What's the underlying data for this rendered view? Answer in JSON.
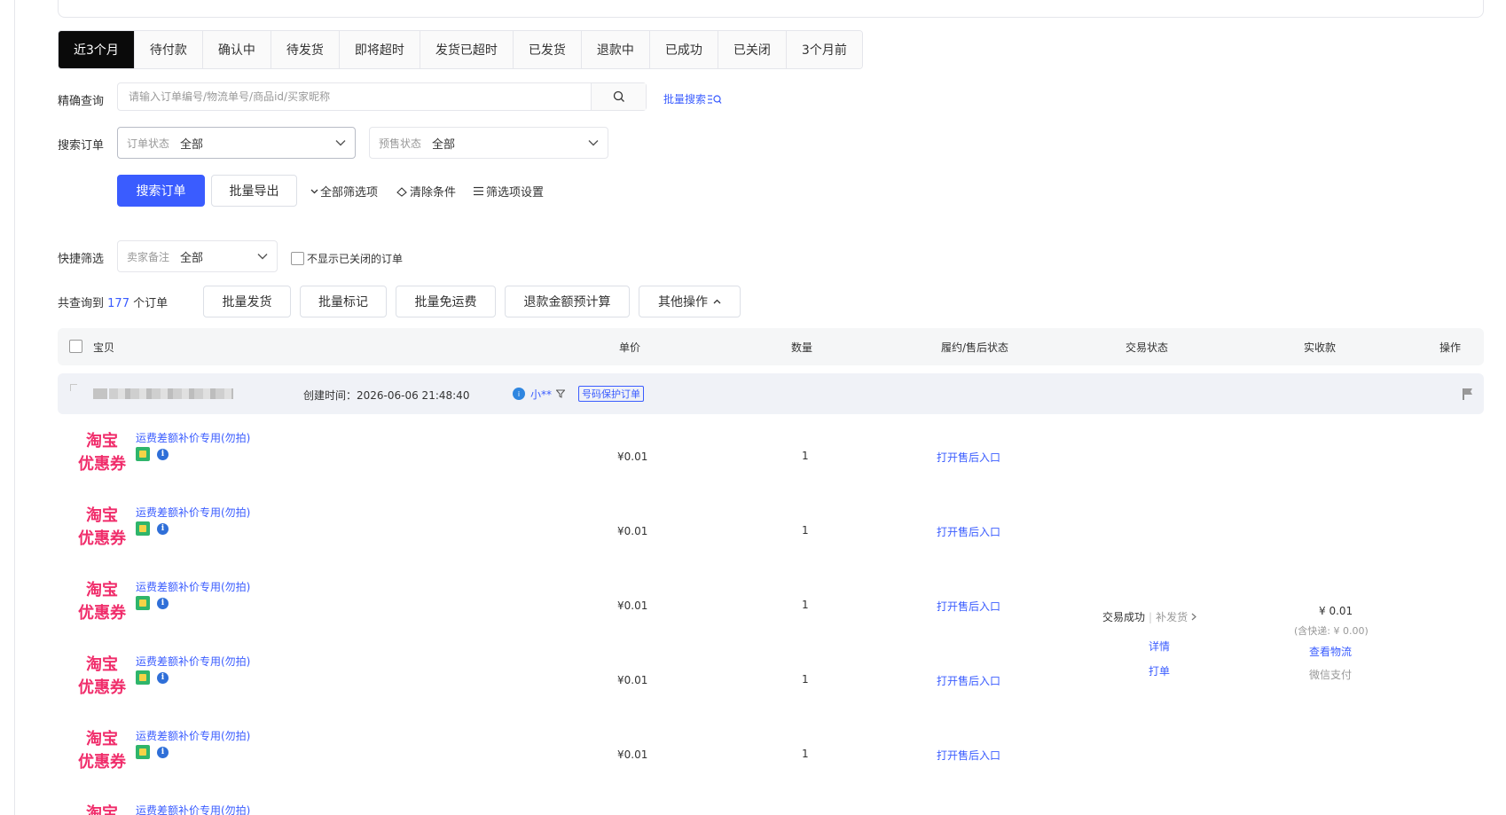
{
  "tabs": [
    {
      "label": "近3个月",
      "active": true
    },
    {
      "label": "待付款"
    },
    {
      "label": "确认中"
    },
    {
      "label": "待发货"
    },
    {
      "label": "即将超时"
    },
    {
      "label": "发货已超时"
    },
    {
      "label": "已发货"
    },
    {
      "label": "退款中"
    },
    {
      "label": "已成功"
    },
    {
      "label": "已关闭"
    },
    {
      "label": "3个月前"
    }
  ],
  "precise": {
    "label": "精确查询",
    "placeholder": "请输入订单编号/物流单号/商品id/买家昵称",
    "batch_search": "批量搜索"
  },
  "search_order": {
    "label": "搜索订单",
    "order_status_label": "订单状态",
    "order_status_value": "全部",
    "presale_label": "预售状态",
    "presale_value": "全部"
  },
  "actions": {
    "search": "搜索订单",
    "export": "批量导出",
    "all_filters": "全部筛选项",
    "clear": "清除条件",
    "filter_settings": "筛选项设置"
  },
  "quick": {
    "label": "快捷筛选",
    "seller_note_label": "卖家备注",
    "seller_note_value": "全部",
    "hide_closed": "不显示已关闭的订单"
  },
  "summary": {
    "prefix": "共查询到",
    "count": "177",
    "suffix": "个订单",
    "buttons": [
      "批量发货",
      "批量标记",
      "批量免运费",
      "退款金额预计算",
      "其他操作"
    ]
  },
  "table_headers": {
    "item": "宝贝",
    "price": "单价",
    "qty": "数量",
    "fulfil": "履约/售后状态",
    "trade": "交易状态",
    "received": "实收款",
    "ops": "操作"
  },
  "order": {
    "created": "创建时间：2026-06-06 21:48:40",
    "buyer": "小**",
    "badge": "号码保护订单",
    "items": [
      {
        "coupon_line1": "淘宝",
        "coupon_line2": "优惠券",
        "name": "运费差额补价专用(勿拍)",
        "price": "¥0.01",
        "qty": "1",
        "after_sale": "打开售后入口"
      },
      {
        "coupon_line1": "淘宝",
        "coupon_line2": "优惠券",
        "name": "运费差额补价专用(勿拍)",
        "price": "¥0.01",
        "qty": "1",
        "after_sale": "打开售后入口"
      },
      {
        "coupon_line1": "淘宝",
        "coupon_line2": "优惠券",
        "name": "运费差额补价专用(勿拍)",
        "price": "¥0.01",
        "qty": "1",
        "after_sale": "打开售后入口"
      },
      {
        "coupon_line1": "淘宝",
        "coupon_line2": "优惠券",
        "name": "运费差额补价专用(勿拍)",
        "price": "¥0.01",
        "qty": "1",
        "after_sale": "打开售后入口"
      },
      {
        "coupon_line1": "淘宝",
        "coupon_line2": "优惠券",
        "name": "运费差额补价专用(勿拍)",
        "price": "¥0.01",
        "qty": "1",
        "after_sale": "打开售后入口"
      },
      {
        "coupon_line1": "淘宝",
        "coupon_line2": "",
        "name": "运费差额补价专用(勿拍)",
        "price": "",
        "qty": "",
        "after_sale": ""
      }
    ],
    "trade_status": "交易成功",
    "resend": "补发货",
    "detail": "详情",
    "print": "打单",
    "amount": "¥ 0.01",
    "shipping": "(含快递: ¥ 0.00)",
    "logistics": "查看物流",
    "payment": "微信支付"
  },
  "colors": {
    "primary": "#3a5cff",
    "coupon": "#f02d6b",
    "active_tab": "#0a0a0a"
  }
}
